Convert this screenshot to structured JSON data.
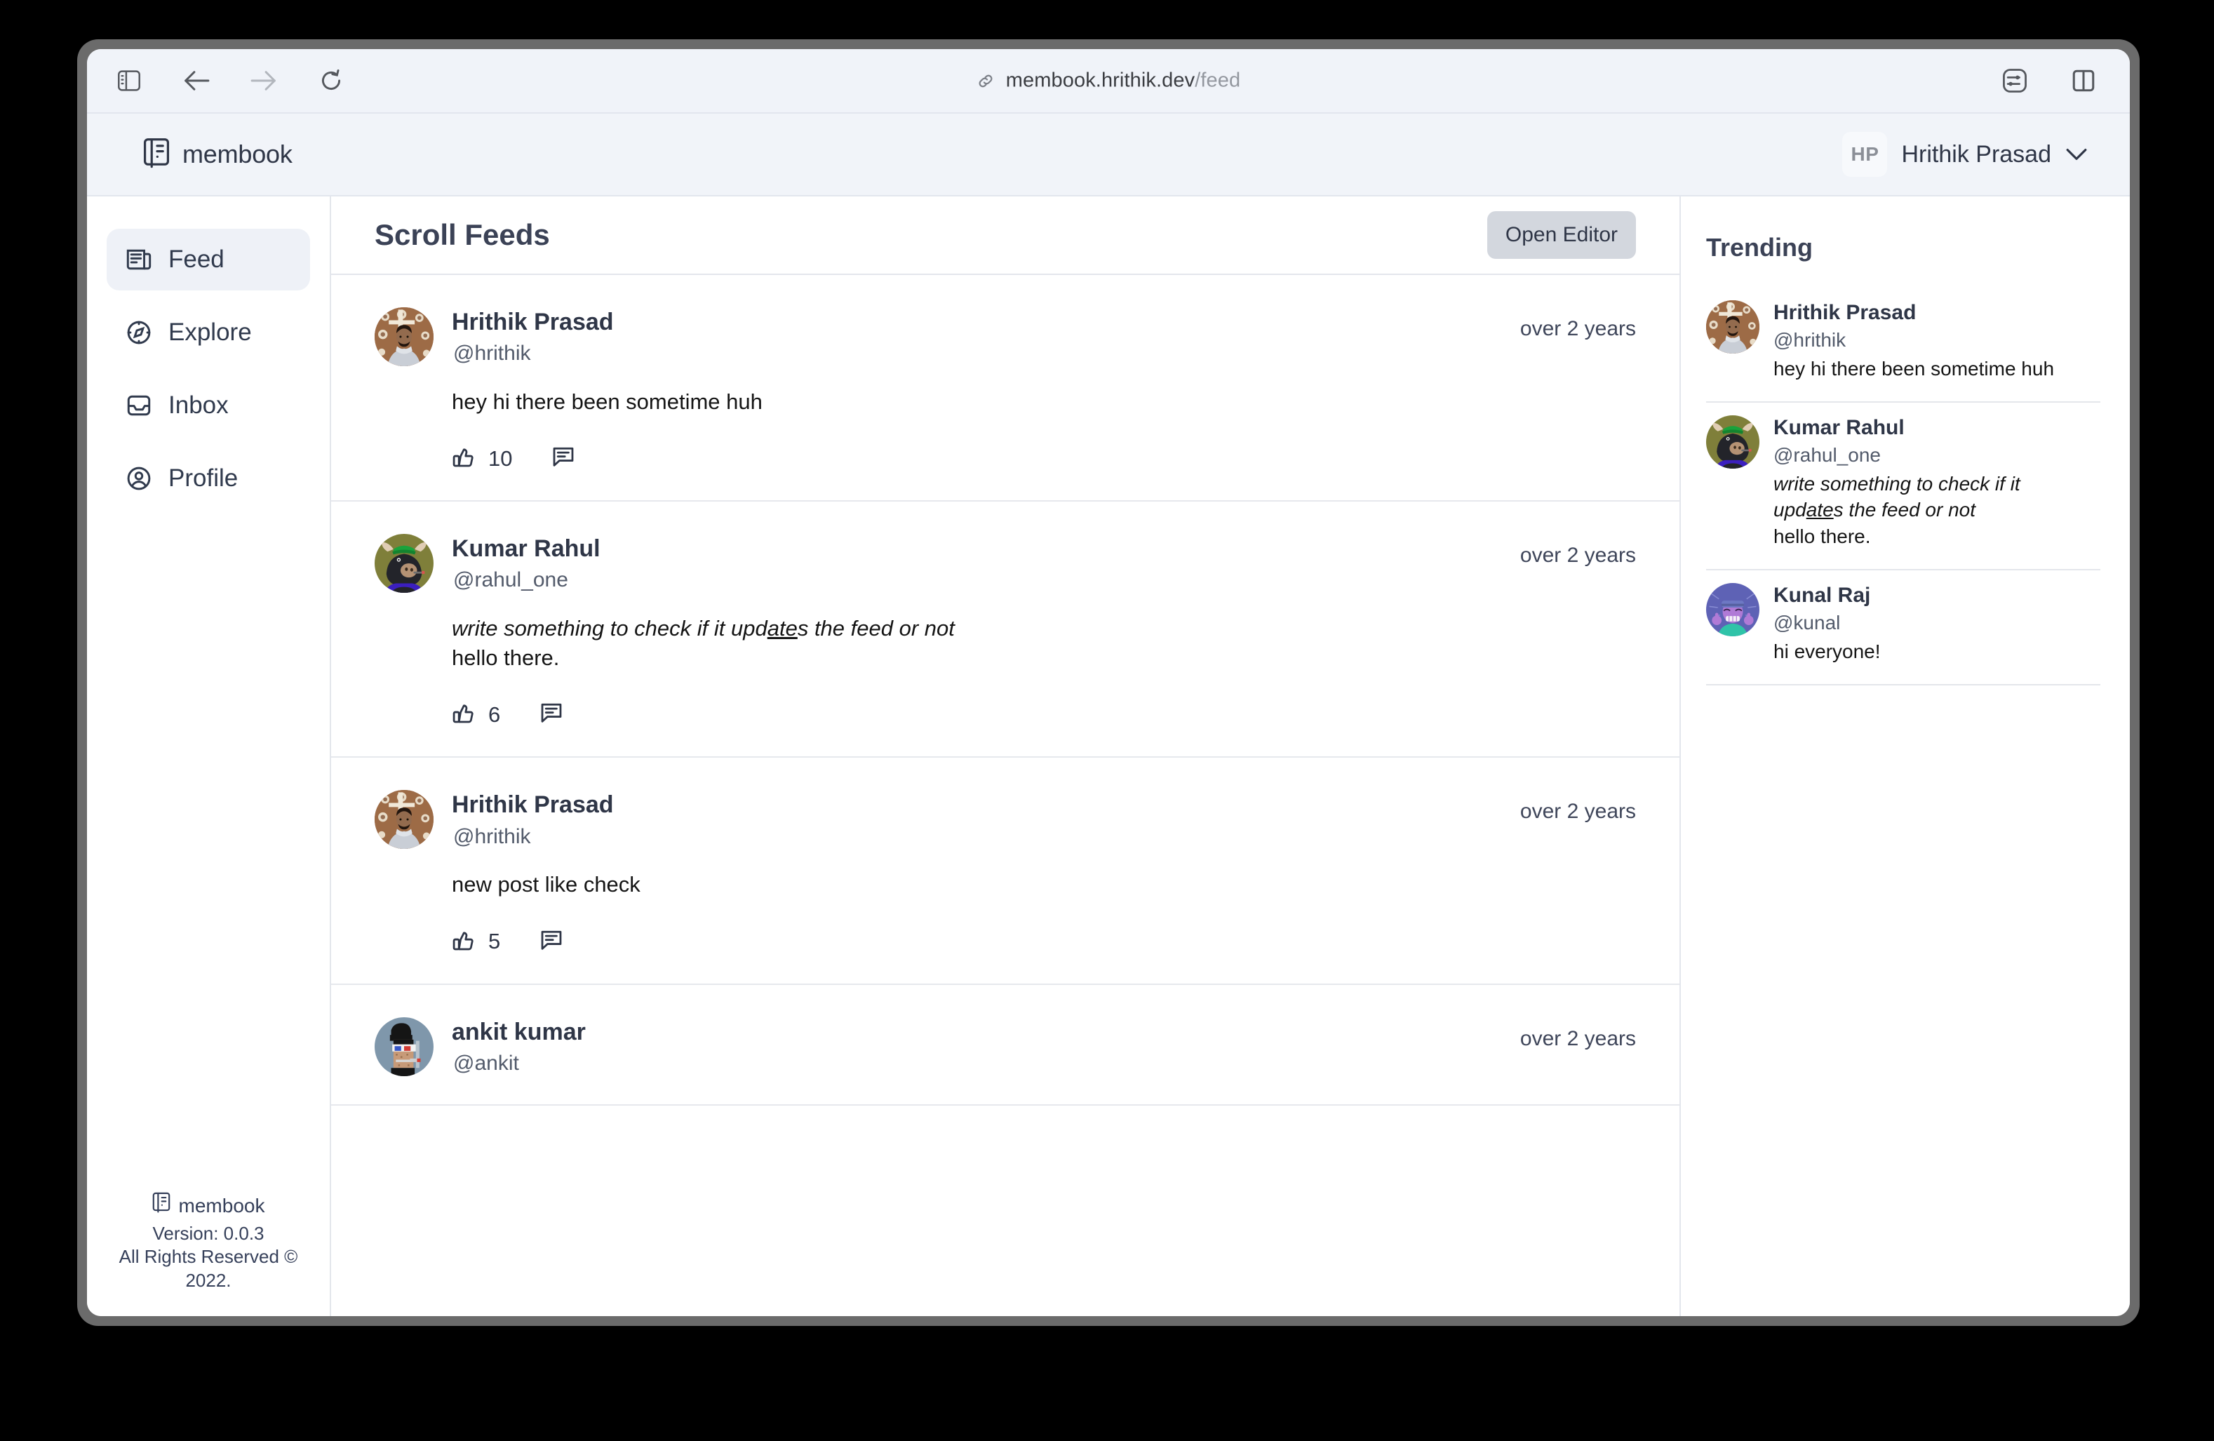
{
  "browser": {
    "url_host": "membook.hrithik.dev",
    "url_path": "/feed",
    "sidebar_toggle_icon": "sidebar-toggle-icon",
    "back_icon": "back-arrow-icon",
    "forward_icon": "forward-arrow-icon",
    "reload_icon": "reload-icon",
    "link_icon": "link-icon",
    "reader_icon": "reader-settings-icon",
    "tabgroup_icon": "split-view-icon"
  },
  "header": {
    "brand": "membook",
    "brand_icon": "membook-logo-icon",
    "user_initials": "HP",
    "user_name": "Hrithik Prasad",
    "chevron_icon": "chevron-down-icon"
  },
  "sidebar": {
    "items": [
      {
        "label": "Feed",
        "icon": "newspaper-icon",
        "active": true
      },
      {
        "label": "Explore",
        "icon": "compass-icon",
        "active": false
      },
      {
        "label": "Inbox",
        "icon": "inbox-icon",
        "active": false
      },
      {
        "label": "Profile",
        "icon": "user-circle-icon",
        "active": false
      }
    ],
    "footer": {
      "brand": "membook",
      "version": "Version: 0.0.3",
      "rights": "All Rights Reserved © 2022."
    }
  },
  "feed": {
    "title": "Scroll Feeds",
    "open_editor_label": "Open Editor",
    "posts": [
      {
        "name": "Hrithik Prasad",
        "handle": "@hrithik",
        "time": "over 2 years",
        "avatar": "photo-hrithik",
        "body_plain": "hey hi there been sometime huh",
        "likes": "10",
        "like_icon": "thumbs-up-icon",
        "comment_icon": "comment-bubble-icon"
      },
      {
        "name": "Kumar Rahul",
        "handle": "@rahul_one",
        "time": "over 2 years",
        "avatar": "pixel-bull",
        "body_line1_a": "write something to check if it upd",
        "body_line1_b": "ate",
        "body_line1_c": "s the feed or not",
        "body_line2": "hello there.",
        "likes": "6",
        "like_icon": "thumbs-up-icon",
        "comment_icon": "comment-bubble-icon"
      },
      {
        "name": "Hrithik Prasad",
        "handle": "@hrithik",
        "time": "over 2 years",
        "avatar": "photo-hrithik",
        "body_plain": "new post like check",
        "likes": "5",
        "like_icon": "thumbs-up-icon",
        "comment_icon": "comment-bubble-icon"
      },
      {
        "name": "ankit kumar",
        "handle": "@ankit",
        "time": "over 2 years",
        "avatar": "pixel-ankit"
      }
    ]
  },
  "trending": {
    "title": "Trending",
    "items": [
      {
        "name": "Hrithik Prasad",
        "handle": "@hrithik",
        "avatar": "photo-hrithik",
        "text_plain": "hey hi there been sometime huh"
      },
      {
        "name": "Kumar Rahul",
        "handle": "@rahul_one",
        "avatar": "pixel-bull",
        "text_line1_a": "write something to check if it",
        "text_line2_a": "upd",
        "text_line2_b": "ate",
        "text_line2_c": "s the feed or not",
        "text_line3": "hello there."
      },
      {
        "name": "Kunal Raj",
        "handle": "@kunal",
        "avatar": "pixel-kunal",
        "text_plain": "hi everyone!"
      }
    ]
  },
  "colors": {
    "app_header_bg": "#f1f4f9",
    "accent_text": "#2f3647",
    "button_bg": "#d3d7de",
    "active_nav_bg": "#eef1f7"
  }
}
